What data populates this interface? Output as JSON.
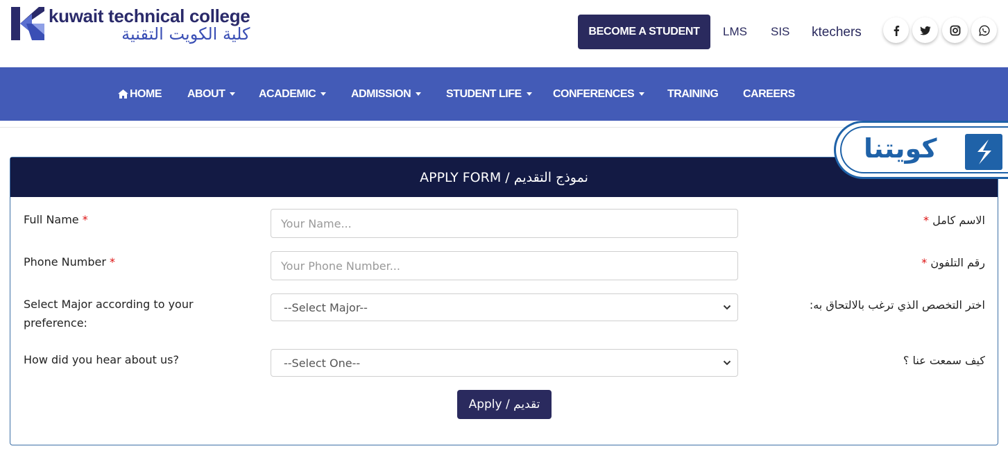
{
  "brand": {
    "name_en": "kuwait technical college",
    "name_ar": "كلية الكويت التقنية"
  },
  "topbar": {
    "become_student": "BECOME A STUDENT",
    "links": [
      "LMS",
      "SIS",
      "ktechers"
    ],
    "social_icons": [
      "facebook-icon",
      "twitter-icon",
      "instagram-icon",
      "whatsapp-icon"
    ]
  },
  "nav": {
    "items": [
      {
        "label": "HOME",
        "icon": "home-icon",
        "dropdown": false
      },
      {
        "label": "ABOUT",
        "dropdown": true
      },
      {
        "label": "ACADEMIC",
        "dropdown": true
      },
      {
        "label": "ADMISSION",
        "dropdown": true
      },
      {
        "label": "STUDENT LIFE",
        "dropdown": true
      },
      {
        "label": "CONFERENCES",
        "dropdown": true
      },
      {
        "label": "TRAINING",
        "dropdown": false
      },
      {
        "label": "CAREERS",
        "dropdown": false
      }
    ]
  },
  "badge": {
    "text": "كويتنا"
  },
  "form": {
    "title": "APPLY FORM / نموذج التقديم",
    "fields": [
      {
        "label_en": "Full Name",
        "label_ar": "الاسم كامل",
        "required": "*",
        "placeholder": "Your Name..."
      },
      {
        "label_en": "Phone Number",
        "label_ar": "رقم التلفون",
        "required": "*",
        "placeholder": "Your Phone Number..."
      },
      {
        "label_en": "Select Major according to your preference:",
        "label_ar": "اختر التخصص الذي ترغب بالالتحاق به:",
        "selected": "--Select Major--"
      },
      {
        "label_en": "How did you hear about us?",
        "label_ar": "كيف سمعت عنا ؟",
        "selected": "--Select One--"
      }
    ],
    "submit_label": "Apply / تقديم"
  },
  "colors": {
    "nav_bg": "#435bb7",
    "dark_navy": "#2a2a5e",
    "panel_head": "#131a44",
    "required": "#dd1111"
  }
}
